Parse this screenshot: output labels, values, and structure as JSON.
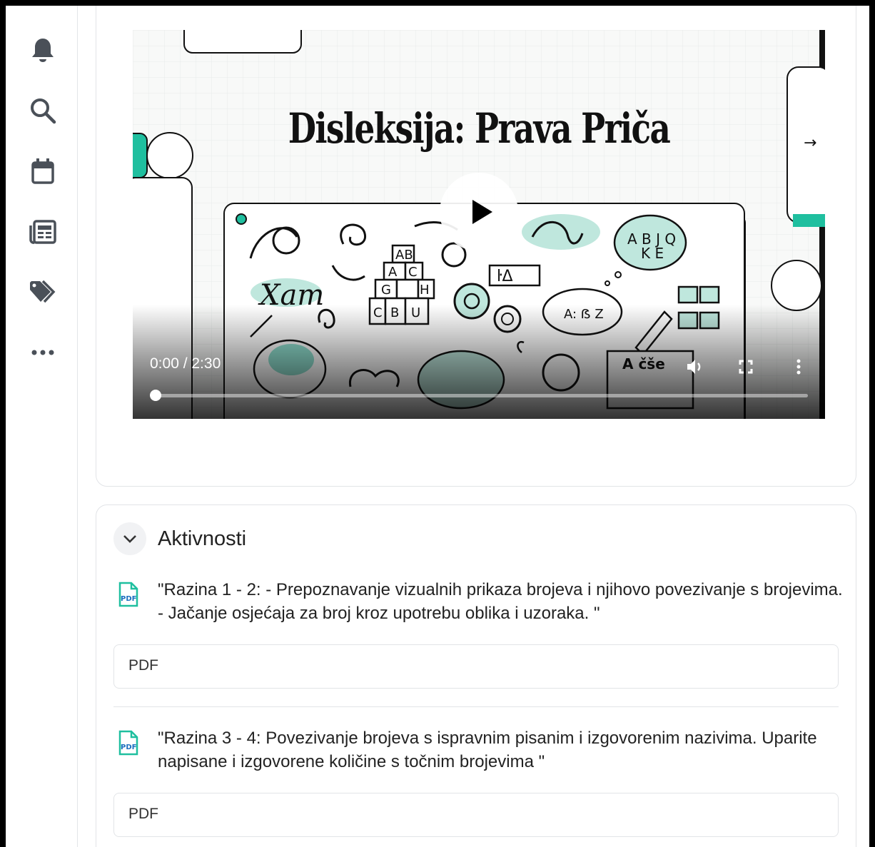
{
  "video": {
    "title": "Disleksija: Prava Priča",
    "time": "0:00 / 2:30",
    "progress": 0
  },
  "sidebar": {
    "icons": [
      "bell-icon",
      "search-icon",
      "calendar-icon",
      "newspaper-icon",
      "tag-icon",
      "more-icon"
    ]
  },
  "activities": {
    "title": "Aktivnosti",
    "items": [
      {
        "text": "\"Razina 1 - 2: - Prepoznavanje vizualnih prikaza brojeva i njihovo povezivanje s brojevima. - Jačanje osjećaja za broj kroz upotrebu oblika i uzoraka. \"",
        "attachment": "PDF"
      },
      {
        "text": "\"Razina 3 - 4: Povezivanje brojeva s ispravnim pisanim i izgovorenim nazivima. Uparite napisane i izgovorene količine s točnim brojevima \"",
        "attachment": "PDF"
      }
    ]
  },
  "colors": {
    "accent": "#1fbf9f",
    "icon": "#4a5058"
  }
}
